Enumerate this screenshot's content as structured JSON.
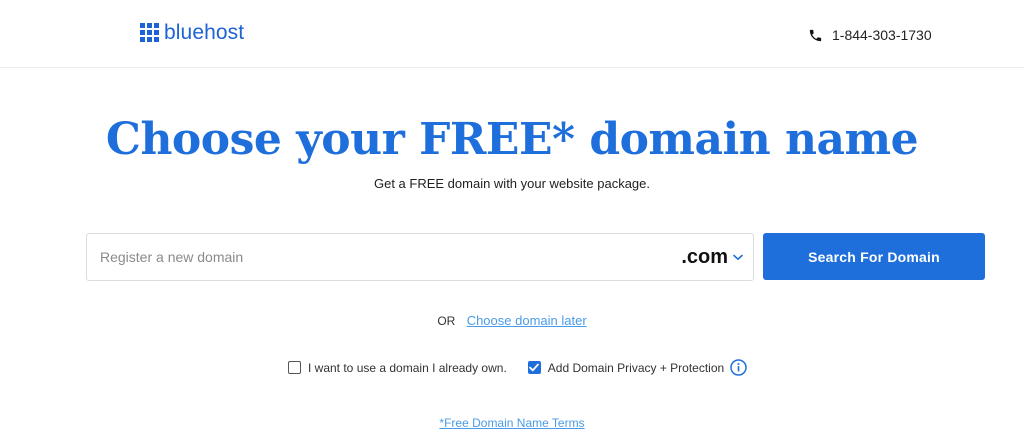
{
  "header": {
    "logo_text": "bluehost",
    "phone_number": "1-844-303-1730"
  },
  "hero": {
    "title": "Choose your FREE* domain name",
    "subtitle": "Get a FREE domain with your website package."
  },
  "search": {
    "placeholder": "Register a new domain",
    "value": "",
    "tld_selected": ".com",
    "button_label": "Search For Domain"
  },
  "alternate": {
    "or_text": "OR",
    "link_label": "Choose domain later"
  },
  "options": {
    "own_domain_label": "I want to use a domain I already own.",
    "own_domain_checked": false,
    "privacy_label": "Add Domain Privacy + Protection",
    "privacy_checked": true
  },
  "footer": {
    "terms_label": "*Free Domain Name Terms"
  },
  "colors": {
    "brand_blue": "#1e6fdb",
    "link_blue": "#4a9be8"
  },
  "icons": {
    "logo": "grid-logo-icon",
    "phone": "phone-icon",
    "tld_dropdown": "chevron-down-icon",
    "checkbox_checked": "checkmark-icon",
    "info": "info-icon"
  }
}
